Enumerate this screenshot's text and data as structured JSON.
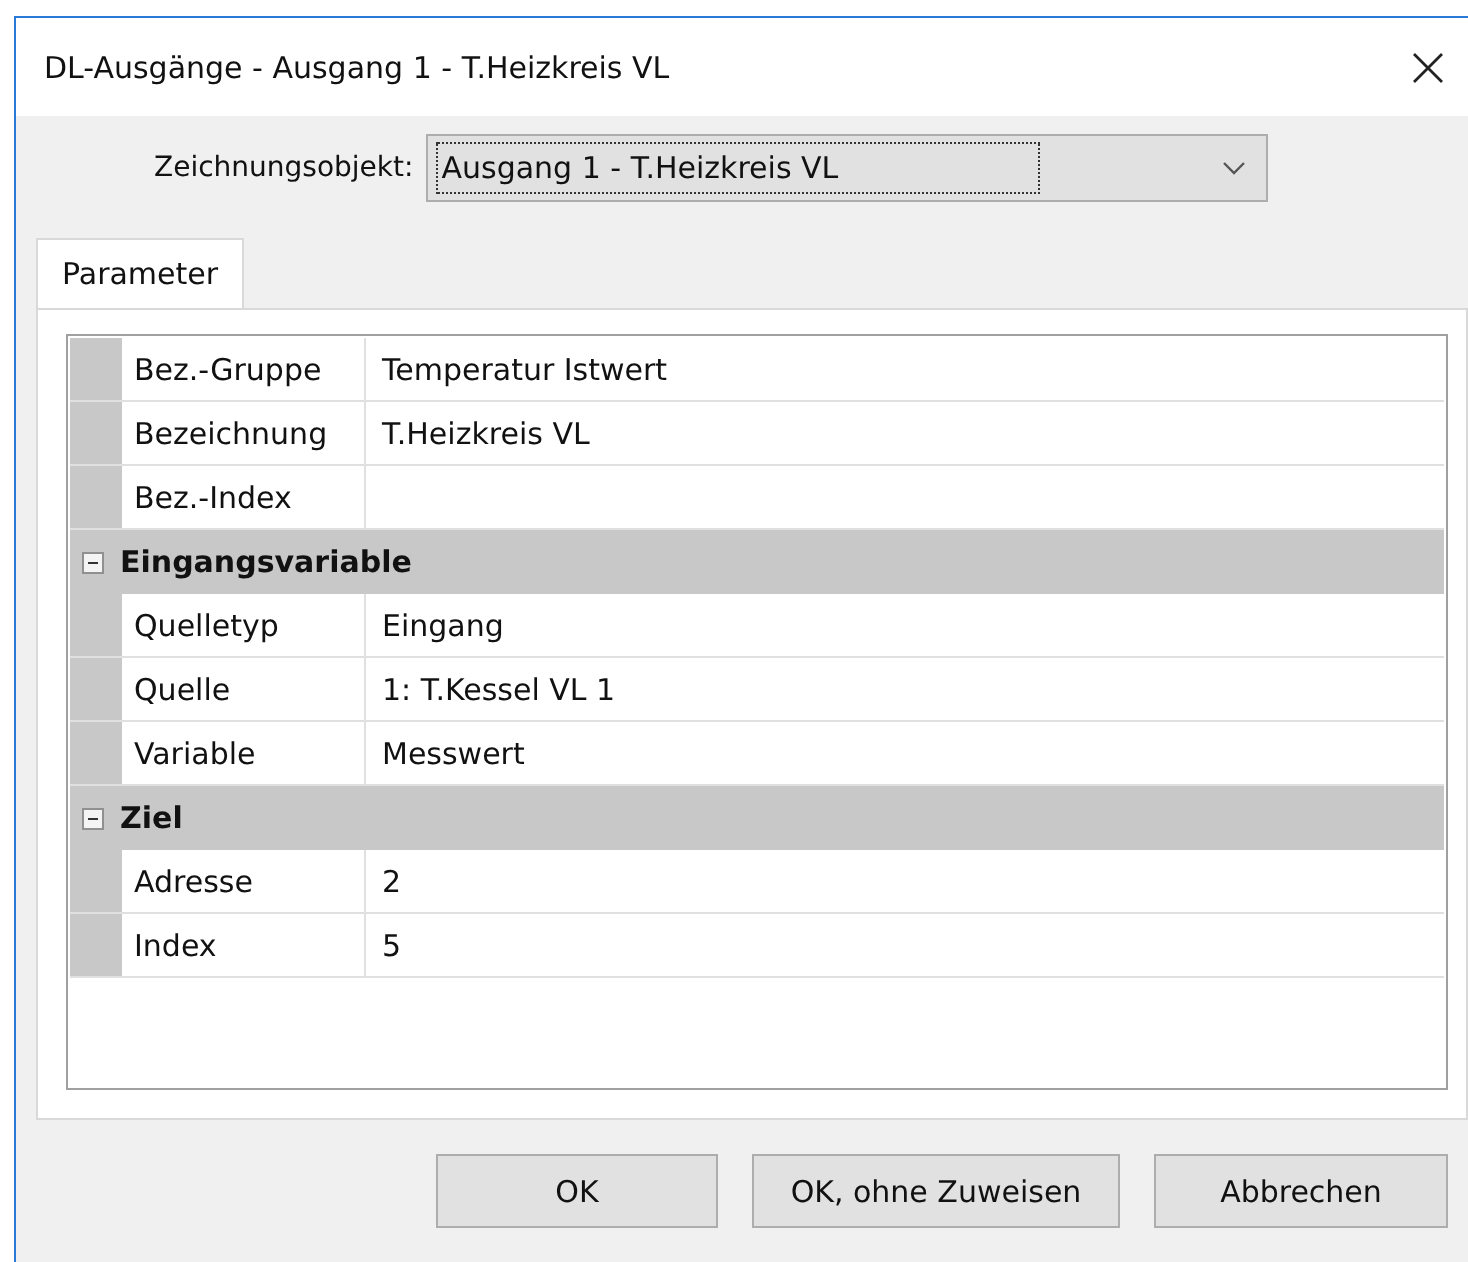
{
  "window": {
    "title": "DL-Ausgänge - Ausgang 1 - T.Heizkreis VL"
  },
  "selector": {
    "label": "Zeichnungsobjekt:",
    "value": "Ausgang 1 - T.Heizkreis VL"
  },
  "tabs": [
    {
      "label": "Parameter",
      "selected": true
    }
  ],
  "grid": {
    "items": [
      {
        "kind": "property",
        "name": "Bez.-Gruppe",
        "value": "Temperatur Istwert"
      },
      {
        "kind": "property",
        "name": "Bezeichnung",
        "value": "T.Heizkreis VL"
      },
      {
        "kind": "property",
        "name": "Bez.-Index"
      },
      {
        "kind": "category",
        "label": "Eingangsvariable",
        "expanded": true,
        "children": [
          {
            "kind": "property",
            "name": "Quelletyp",
            "value": "Eingang"
          },
          {
            "kind": "property",
            "name": "Quelle",
            "value": "1: T.Kessel VL 1"
          },
          {
            "kind": "property",
            "name": "Variable",
            "value": "Messwert"
          }
        ]
      },
      {
        "kind": "category",
        "label": "Ziel",
        "expanded": true,
        "children": [
          {
            "kind": "property",
            "name": "Adresse",
            "value": "2"
          },
          {
            "kind": "property",
            "name": "Index",
            "value": "5"
          }
        ]
      }
    ]
  },
  "buttons": [
    "OK",
    "OK, ohne Zuweisen",
    "Abbrechen"
  ]
}
